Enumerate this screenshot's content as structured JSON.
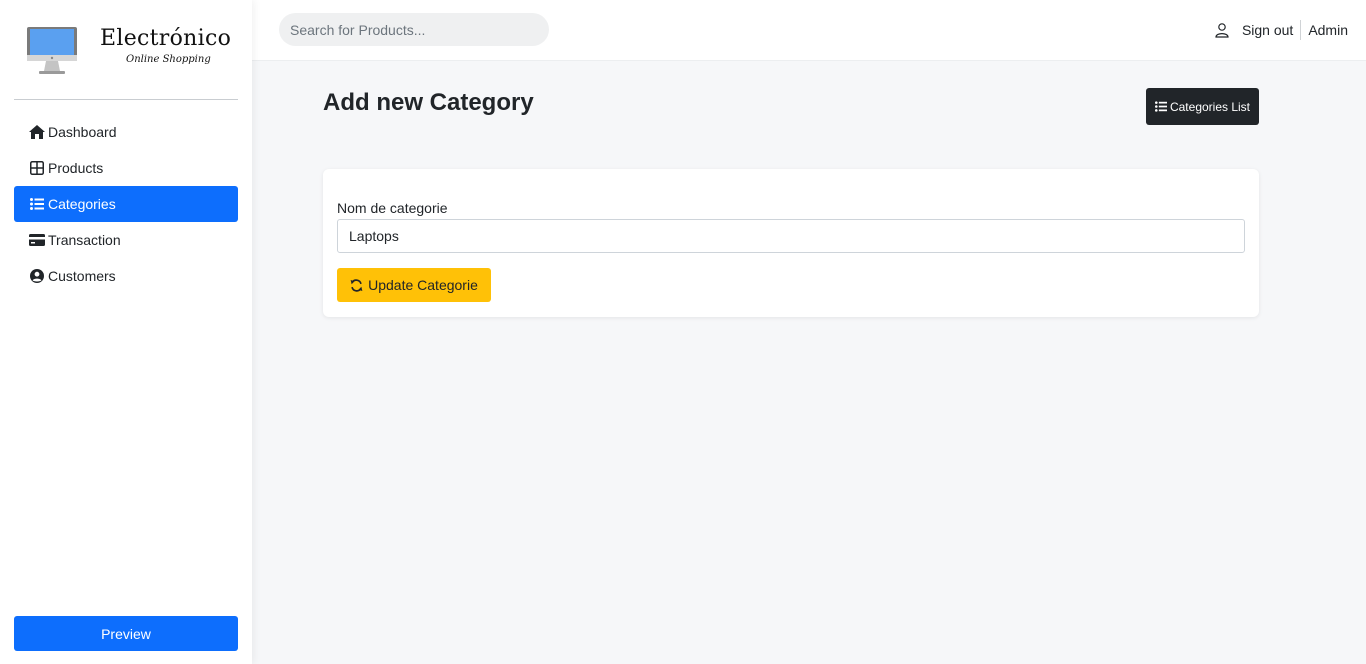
{
  "brand": {
    "name": "Electrónico",
    "tagline": "Online Shopping",
    "logo_icon": "monitor-icon"
  },
  "sidebar": {
    "items": [
      {
        "label": "Dashboard",
        "icon": "home-icon",
        "active": false
      },
      {
        "label": "Products",
        "icon": "grid-icon",
        "active": false
      },
      {
        "label": "Categories",
        "icon": "list-icon",
        "active": true
      },
      {
        "label": "Transaction",
        "icon": "credit-card-icon",
        "active": false
      },
      {
        "label": "Customers",
        "icon": "user-circle-icon",
        "active": false
      }
    ],
    "preview_label": "Preview"
  },
  "header": {
    "search_placeholder": "Search for Products...",
    "signout_label": "Sign out",
    "user_label": "Admin"
  },
  "main": {
    "title": "Add new Category",
    "list_button_label": "Categories List",
    "form": {
      "field_label": "Nom de categorie",
      "field_value": "Laptops",
      "submit_label": "Update Categorie"
    }
  },
  "colors": {
    "primary": "#0d6efd",
    "warning": "#ffc107",
    "dark": "#212529",
    "background": "#f6f7f9"
  }
}
